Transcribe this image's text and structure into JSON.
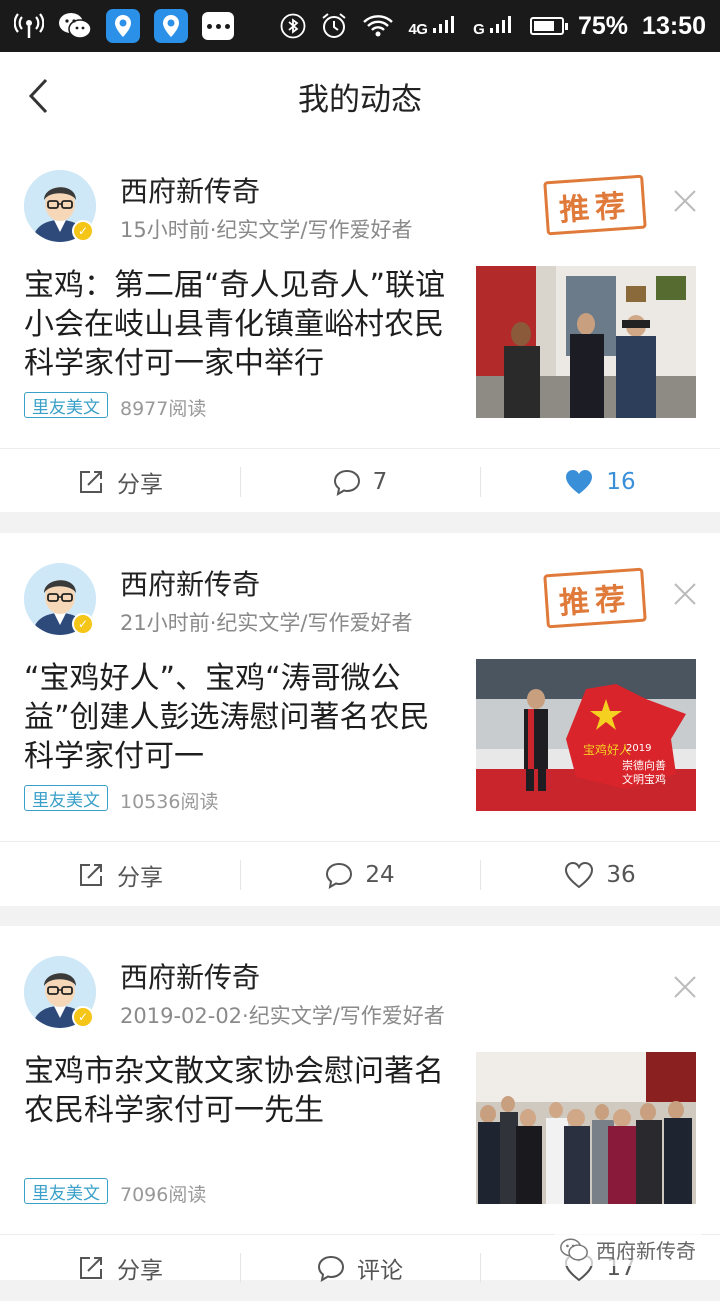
{
  "statusbar": {
    "network_1": "4G",
    "network_2": "G",
    "battery_pct": "75%",
    "time": "13:50",
    "battery_level": 0.75
  },
  "header": {
    "title": "我的动态"
  },
  "posts": [
    {
      "author": "西府新传奇",
      "meta": "15小时前·纪实文学/写作爱好者",
      "stamp": "推荐",
      "title": "宝鸡：第二届“奇人见奇人”联谊小会在岐山县青化镇童峪村农民科学家付可一家中举行",
      "tag": "里友美文",
      "reads": "8977阅读",
      "share": "分享",
      "comments": "7",
      "likes": "16",
      "liked": true
    },
    {
      "author": "西府新传奇",
      "meta": "21小时前·纪实文学/写作爱好者",
      "stamp": "推荐",
      "title": "“宝鸡好人”、宝鸡“涛哥微公益”创建人彭选涛慰问著名农民科学家付可一",
      "tag": "里友美文",
      "reads": "10536阅读",
      "share": "分享",
      "comments": "24",
      "likes": "36",
      "liked": false,
      "image_text_1": "宝鸡好人",
      "image_text_2": "崇德向善",
      "image_text_3": "文明宝鸡",
      "image_text_4": "2019"
    },
    {
      "author": "西府新传奇",
      "meta": "2019-02-02·纪实文学/写作爱好者",
      "title": "宝鸡市杂文散文家协会慰问著名农民科学家付可一先生",
      "tag": "里友美文",
      "reads": "7096阅读",
      "share": "分享",
      "comments": "评论",
      "likes": "17",
      "liked": false
    }
  ],
  "watermark": "西府新传奇"
}
